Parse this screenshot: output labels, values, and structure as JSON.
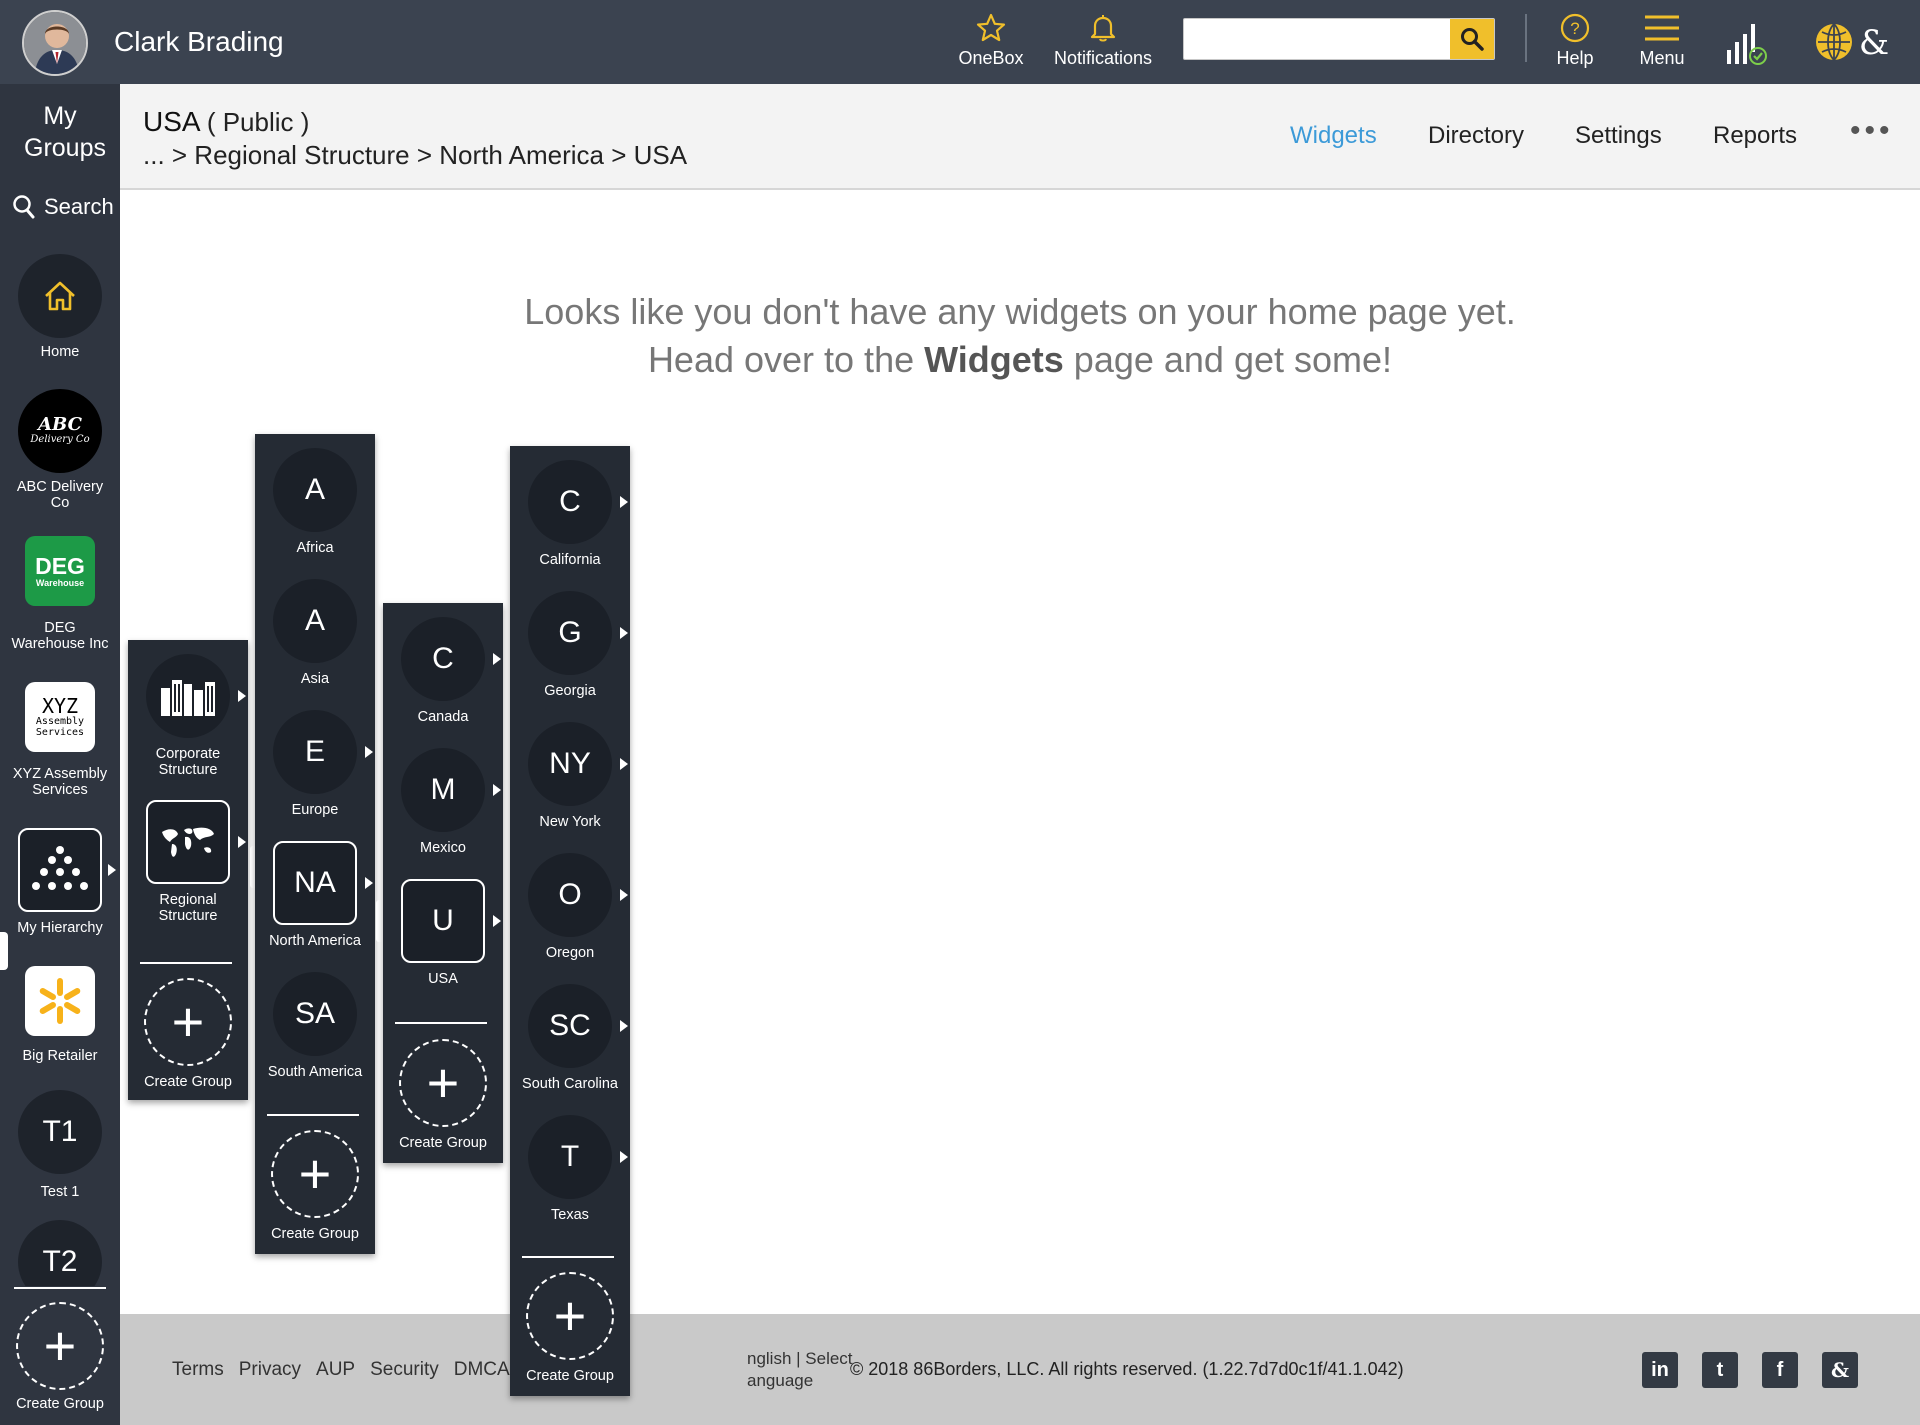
{
  "topbar": {
    "user_name": "Clark Brading",
    "onebox_label": "OneBox",
    "notifications_label": "Notifications",
    "search": {
      "value": "",
      "placeholder": ""
    },
    "help_label": "Help",
    "menu_label": "Menu",
    "accent_color": "#f0bf2b",
    "bar_color": "#3b4350"
  },
  "leftrail": {
    "my_groups": "My Groups",
    "search_label": "Search",
    "items": [
      {
        "label": "Home",
        "icon": "home-icon"
      },
      {
        "label": "ABC Delivery Co",
        "logo_text_1": "ABC",
        "logo_text_2": "Delivery Co"
      },
      {
        "label": "DEG Warehouse Inc",
        "logo_text_1": "DEG",
        "logo_text_2": "Warehouse"
      },
      {
        "label": "XYZ Assembly Services",
        "logo_text_1": "XYZ",
        "logo_text_2": "Assembly Services"
      },
      {
        "label": "My Hierarchy",
        "icon": "hierarchy-icon"
      },
      {
        "label": "Big Retailer",
        "icon": "spark-icon"
      },
      {
        "label": "Test 1",
        "initials": "T1"
      },
      {
        "label": "",
        "initials": "T2"
      }
    ],
    "create_group": "Create Group"
  },
  "subheader": {
    "title": "USA",
    "visibility": "( Public )",
    "breadcrumb": "... > Regional Structure > North America > USA",
    "tabs": {
      "widgets": "Widgets",
      "directory": "Directory",
      "settings": "Settings",
      "reports": "Reports",
      "more": "•••"
    },
    "active_tab_color": "#3c9ad8"
  },
  "main": {
    "empty_line_1": "Looks like you don't have any widgets on your home page yet.",
    "empty_line_2_prefix": "Head over to the ",
    "empty_line_2_bold": "Widgets",
    "empty_line_2_suffix": " page and get some!"
  },
  "hierarchy": {
    "col1": [
      {
        "label": "Corporate Structure",
        "icon": "buildings-icon"
      },
      {
        "label": "Regional Structure",
        "icon": "world-map-icon"
      }
    ],
    "col2": [
      {
        "initials": "A",
        "label": "Africa"
      },
      {
        "initials": "A",
        "label": "Asia"
      },
      {
        "initials": "E",
        "label": "Europe"
      },
      {
        "initials": "NA",
        "label": "North America"
      },
      {
        "initials": "SA",
        "label": "South America"
      }
    ],
    "col3": [
      {
        "initials": "C",
        "label": "Canada"
      },
      {
        "initials": "M",
        "label": "Mexico"
      },
      {
        "initials": "U",
        "label": "USA"
      }
    ],
    "col4": [
      {
        "initials": "C",
        "label": "California"
      },
      {
        "initials": "G",
        "label": "Georgia"
      },
      {
        "initials": "NY",
        "label": "New York"
      },
      {
        "initials": "O",
        "label": "Oregon"
      },
      {
        "initials": "SC",
        "label": "South Carolina"
      },
      {
        "initials": "T",
        "label": "Texas"
      }
    ],
    "create_group": "Create Group"
  },
  "footer": {
    "links": [
      "Terms",
      "Privacy",
      "AUP",
      "Security",
      "DMCA"
    ],
    "lang_line_1": "nglish | Select",
    "lang_line_2": "anguage",
    "copyright": "© 2018 86Borders, LLC. All rights reserved. (1.22.7d7d0c1f/41.1.042)",
    "social": [
      "linkedin-icon",
      "twitter-icon",
      "facebook-icon",
      "86borders-icon"
    ]
  }
}
